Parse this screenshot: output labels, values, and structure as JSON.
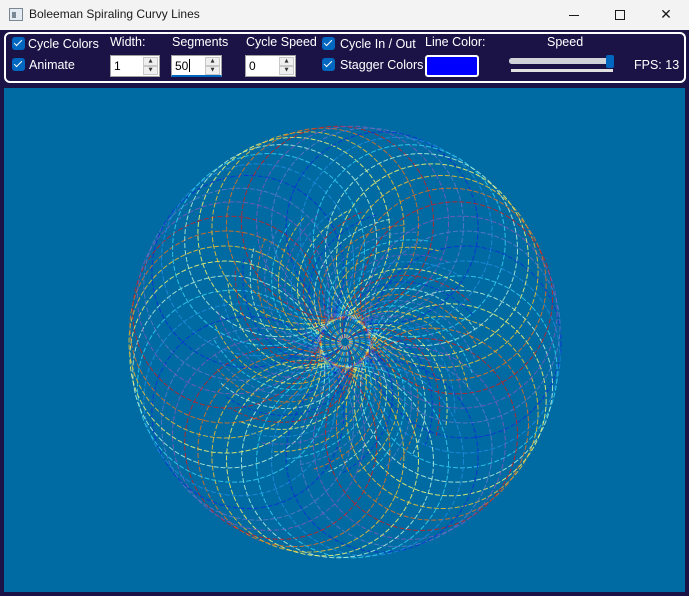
{
  "window": {
    "title": "Boleeman Spiraling Curvy Lines",
    "controls": {
      "minimize": "—",
      "maximize": "☐",
      "close": "✕"
    }
  },
  "toolbar": {
    "cycle_colors": {
      "label": "Cycle Colors",
      "checked": true
    },
    "animate": {
      "label": "Animate",
      "checked": true
    },
    "width": {
      "label": "Width:",
      "value": "1"
    },
    "segments": {
      "label": "Segments",
      "value": "50"
    },
    "cycle_speed": {
      "label": "Cycle Speed",
      "value": "0"
    },
    "cycle_in_out": {
      "label": "Cycle In / Out",
      "checked": true
    },
    "stagger_colors": {
      "label": "Stagger Colors",
      "checked": true
    },
    "line_color": {
      "label": "Line Color:",
      "value": "#0000ff"
    },
    "speed": {
      "label": "Speed",
      "value_fraction": 0.98
    },
    "fps": {
      "label": "FPS: 13"
    }
  },
  "canvas": {
    "background": "#006ba2",
    "line_palette": [
      "#0a2fd8",
      "#1f8ce0",
      "#33d0f0",
      "#b8f0d8",
      "#f4f470",
      "#f0c030",
      "#e07020",
      "#c82020",
      "#7a5ab8",
      "#5e78c8"
    ]
  }
}
